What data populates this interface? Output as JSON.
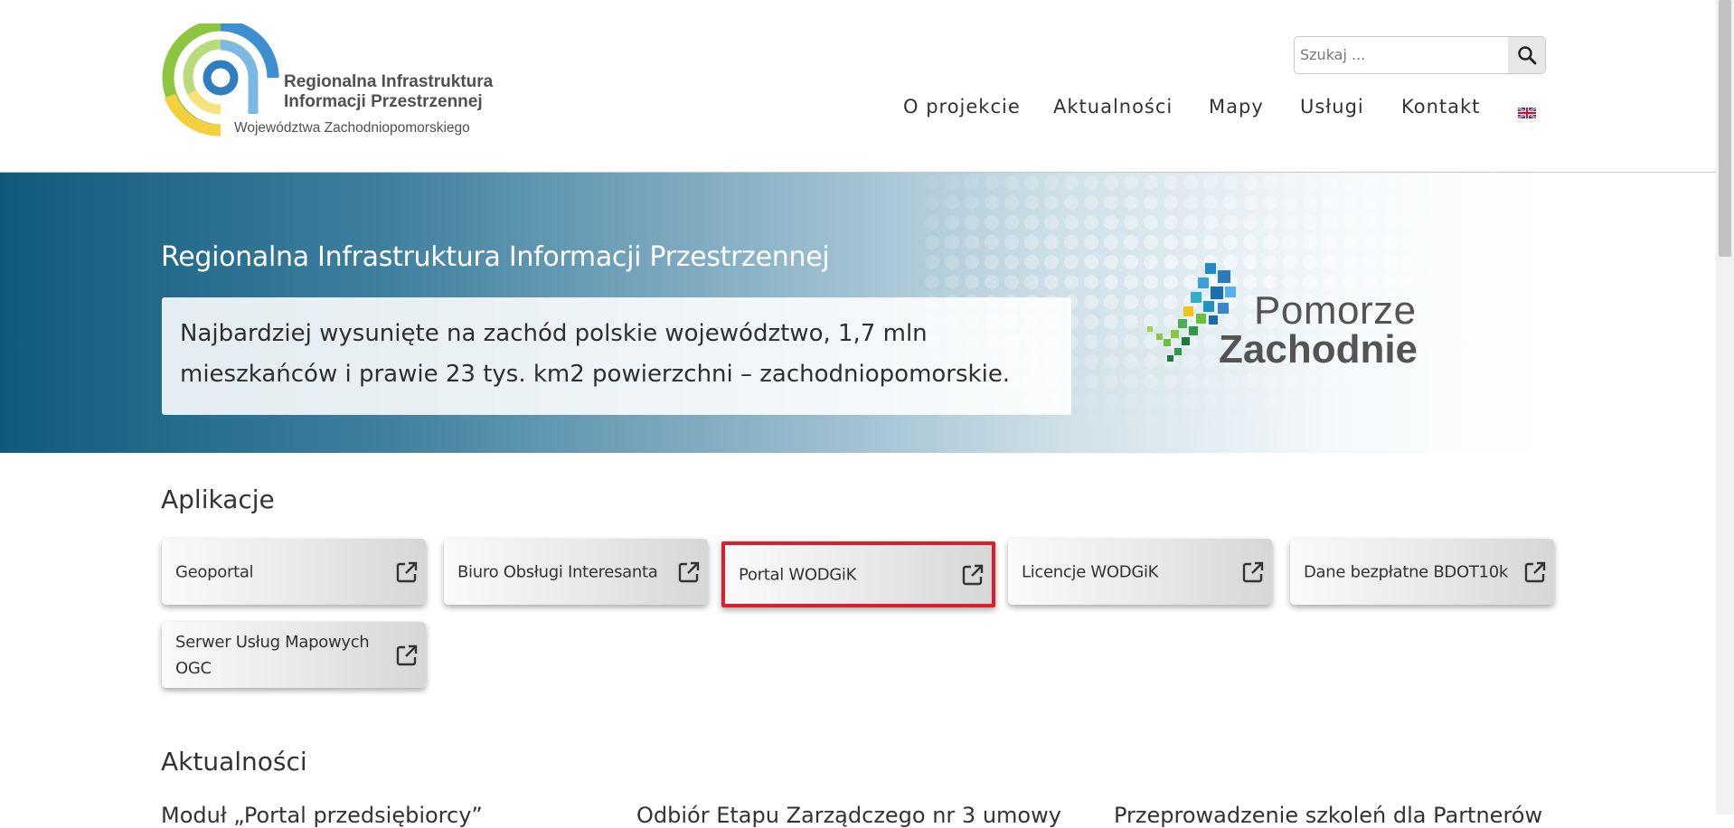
{
  "header": {
    "logo": {
      "line1": "Regionalna Infrastruktura",
      "line2": "Informacji Przestrzennej",
      "line3": "Województwa Zachodniopomorskiego"
    },
    "search": {
      "placeholder": "Szukaj ...",
      "value": ""
    },
    "nav": [
      {
        "label": "O projekcie"
      },
      {
        "label": "Aktualności"
      },
      {
        "label": "Mapy"
      },
      {
        "label": "Usługi"
      },
      {
        "label": "Kontakt"
      }
    ]
  },
  "hero": {
    "title": "Regionalna Infrastruktura Informacji Przestrzennej",
    "description": "Najbardziej wysunięte na zachód polskie województwo, 1,7 mln mieszkańców i prawie 23 tys. km2 powierzchni – zachodniopomorskie.",
    "brand_line1": "Pomorze",
    "brand_line2": "Zachodnie"
  },
  "apps": {
    "title": "Aplikacje",
    "items": [
      {
        "label": "Geoportal"
      },
      {
        "label": "Biuro Obsługi Interesanta"
      },
      {
        "label": "Portal WODGiK"
      },
      {
        "label": "Licencje WODGiK"
      },
      {
        "label": "Dane bezpłatne BDOT10k"
      },
      {
        "label": "Serwer Usług Mapowych OGC"
      }
    ]
  },
  "news": {
    "title": "Aktualności",
    "items": [
      {
        "title": "Moduł „Portal przedsiębiorcy”"
      },
      {
        "title": "Odbiór Etapu Zarządczego nr 3 umowy"
      },
      {
        "title": "Przeprowadzenie szkoleń dla Partnerów"
      }
    ]
  },
  "colors": {
    "highlight": "#d9202a",
    "hero_dark": "#0f5a7c",
    "logo_green": "#8cc63f",
    "logo_blue": "#3d8fcf",
    "logo_yellow": "#f4d03f"
  }
}
